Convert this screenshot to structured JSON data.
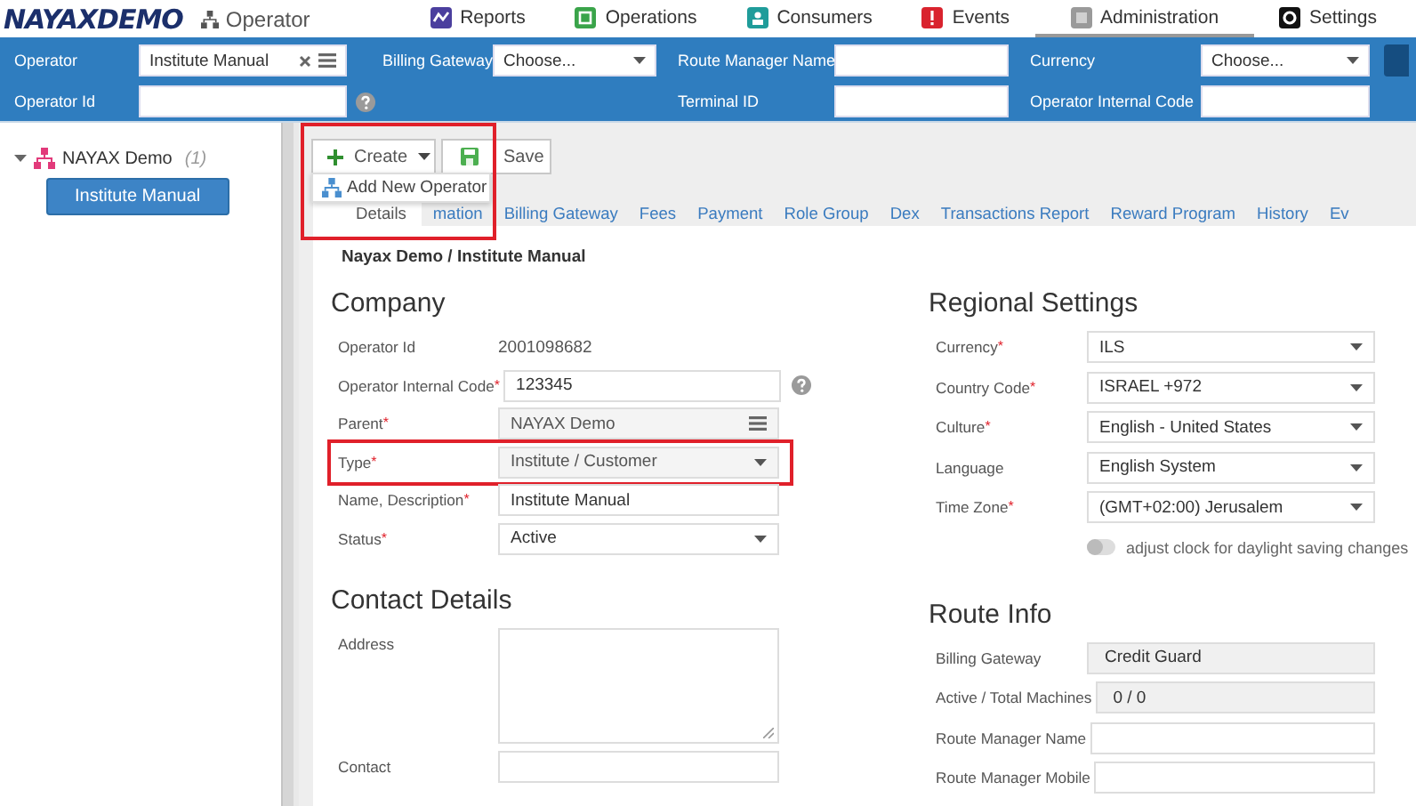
{
  "header": {
    "logo": "NAYAXDEMO",
    "page": "Operator",
    "nav": [
      {
        "label": "Reports",
        "selected": false
      },
      {
        "label": "Operations",
        "selected": false
      },
      {
        "label": "Consumers",
        "selected": false
      },
      {
        "label": "Events",
        "selected": false
      },
      {
        "label": "Administration",
        "selected": true
      },
      {
        "label": "Settings",
        "selected": false
      }
    ]
  },
  "filters": [
    [
      {
        "label": "Operator",
        "kind": "lookup",
        "value": "Institute Manual"
      },
      {
        "label": "Operator Id",
        "kind": "input",
        "help": true
      }
    ],
    [
      {
        "label": "Billing Gateway",
        "kind": "select",
        "value": "Choose..."
      }
    ],
    [
      {
        "label": "Route Manager Name",
        "kind": "input"
      },
      {
        "label": "Terminal ID",
        "kind": "input"
      }
    ],
    [
      {
        "label": "Currency",
        "kind": "select",
        "value": "Choose..."
      },
      {
        "label": "Operator Internal Code",
        "kind": "input"
      }
    ]
  ],
  "tree": [
    {
      "label": "NAYAX Demo",
      "count": "(1)",
      "expanded": true,
      "children": [
        {
          "label": "Institute Manual",
          "selected": true
        }
      ]
    }
  ],
  "toolbar": {
    "highlighted": true,
    "buttons": [
      {
        "label": "Create",
        "kind": "create"
      },
      {
        "label": "Save",
        "kind": "save"
      }
    ],
    "menu": [
      {
        "label": "Add New Operator"
      }
    ]
  },
  "tabs": [
    {
      "label": "Details",
      "selected": true
    },
    {
      "label": "mation",
      "selected": false
    },
    {
      "label": "Billing Gateway",
      "selected": false
    },
    {
      "label": "Fees",
      "selected": false
    },
    {
      "label": "Payment",
      "selected": false
    },
    {
      "label": "Role Group",
      "selected": false
    },
    {
      "label": "Dex",
      "selected": false
    },
    {
      "label": "Transactions Report",
      "selected": false
    },
    {
      "label": "Reward Program",
      "selected": false
    },
    {
      "label": "History",
      "selected": false
    },
    {
      "label": "Ev",
      "selected": false
    }
  ],
  "breadcrumb": "Nayax Demo / Institute Manual",
  "columns": [
    [
      {
        "title": "Company",
        "rows": [
          {
            "label": "Operator Id",
            "kind": "static",
            "value": "2001098682"
          },
          {
            "label": "Operator Internal Code",
            "asterisk": "*",
            "kind": "input",
            "value": "123345",
            "help": true
          },
          {
            "label": "Parent",
            "asterisk": "*",
            "kind": "lookup",
            "value": "NAYAX Demo",
            "disabled": true
          },
          {
            "label": "Type",
            "asterisk": "*",
            "kind": "select",
            "value": "Institute / Customer",
            "disabled": true,
            "highlighted": true
          },
          {
            "label": "Name, Description",
            "asterisk": "*",
            "kind": "input",
            "value": "Institute Manual"
          },
          {
            "label": "Status",
            "asterisk": "*",
            "kind": "select",
            "value": "Active",
            "disabled": false
          }
        ]
      },
      {
        "title": "Contact Details",
        "rows": [
          {
            "label": "Address",
            "kind": "textarea"
          },
          {
            "label": "Contact",
            "kind": "input"
          }
        ]
      }
    ],
    [
      {
        "title": "Regional Settings",
        "rows": [
          {
            "label": "Currency",
            "asterisk": "*",
            "kind": "select",
            "value": "ILS",
            "disabled": false
          },
          {
            "label": "Country Code",
            "asterisk": "*",
            "kind": "select",
            "value": "ISRAEL +972",
            "disabled": false
          },
          {
            "label": "Culture",
            "asterisk": "*",
            "kind": "select",
            "value": "English - United States",
            "disabled": false
          },
          {
            "label": "Language",
            "kind": "select",
            "value": "English System",
            "disabled": false
          },
          {
            "label": "Time Zone",
            "asterisk": "*",
            "kind": "select",
            "value": "(GMT+02:00) Jerusalem",
            "disabled": false
          },
          {
            "kind": "toggle",
            "label": "adjust clock for daylight saving changes",
            "on": false
          }
        ]
      },
      {
        "title": "Route Info",
        "rows": [
          {
            "label": "Billing Gateway",
            "kind": "readonly",
            "value": "Credit Guard"
          },
          {
            "label": "Active / Total Machines",
            "kind": "readonly",
            "value": "0 / 0"
          },
          {
            "label": "Route Manager Name",
            "kind": "input"
          },
          {
            "label": "Route Manager Mobile",
            "kind": "input"
          }
        ]
      }
    ]
  ]
}
